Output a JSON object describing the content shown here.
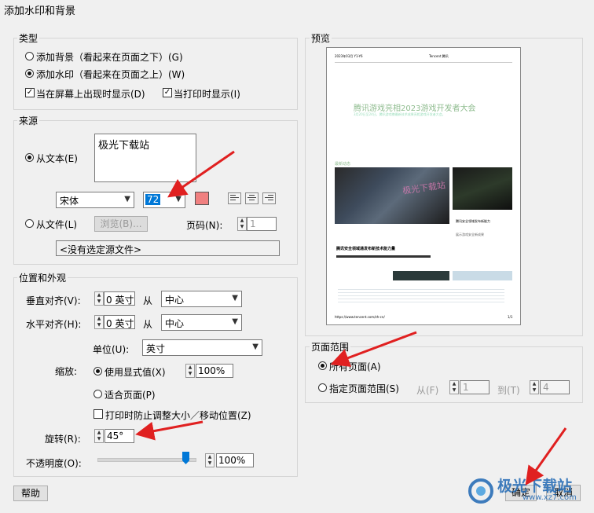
{
  "window_title": "添加水印和背景",
  "type_group": {
    "label": "类型",
    "add_background": "添加背景（看起来在页面之下）(G)",
    "add_watermark": "添加水印（看起来在页面之上）(W)",
    "show_on_screen": "当在屏幕上出现时显示(D)",
    "show_on_print": "当打印时显示(I)"
  },
  "source_group": {
    "label": "来源",
    "from_text": "从文本(E)",
    "text_value": "极光下载站",
    "font": "宋体",
    "font_size": "72",
    "from_file": "从文件(L)",
    "browse": "浏览(B)...",
    "page_label": "页码(N):",
    "page_value": "1",
    "file_path": "<没有选定源文件>"
  },
  "position_group": {
    "label": "位置和外观",
    "vertical_label": "垂直对齐(V):",
    "vertical_value": "0 英寸",
    "from1": "从",
    "vertical_anchor": "中心",
    "horizontal_label": "水平对齐(H):",
    "horizontal_value": "0 英寸",
    "from2": "从",
    "horizontal_anchor": "中心",
    "unit_label": "单位(U):",
    "unit_value": "英寸",
    "scale_label": "缩放:",
    "use_display_value": "使用显式值(X)",
    "scale_value": "100%",
    "fit_page": "适合页面(P)",
    "prevent_resize": "打印时防止调整大小／移动位置(Z)",
    "rotation_label": "旋转(R):",
    "rotation_value": "45°",
    "opacity_label": "不透明度(O):",
    "opacity_value": "100%"
  },
  "preview": {
    "label": "预览",
    "doc_header_left": "2023年03月 Y1-Y6",
    "doc_header_right": "Tencent 腾讯",
    "doc_title": "腾讯游戏亮相2023游戏开发者大会",
    "doc_subtitle": "3月20日至24日，腾讯游戏携最新技术成果亮相游戏开发者大会。",
    "doc_section": "最新动态",
    "doc_card_title": "腾讯安全领域发布新能力",
    "doc_card_desc": "展示游戏安全新成果",
    "doc_news_title": "腾讯安全领域通发布新技术能力量",
    "doc_footer_left": "https://www.tencent.com/zh-cn/",
    "doc_footer_right": "1/1"
  },
  "page_range_group": {
    "label": "页面范围",
    "all_pages": "所有页面(A)",
    "specified_range": "指定页面范围(S)",
    "from": "从(F)",
    "from_value": "1",
    "to": "到(T)",
    "to_value": "4"
  },
  "buttons": {
    "help": "帮助",
    "ok": "确定",
    "cancel": "取消"
  },
  "watermark_logo": {
    "text": "极光下载站",
    "url": "www.xz7.com"
  },
  "colors": {
    "swatch": "#f08080",
    "arrow": "#e02020",
    "preview_title": "#8fbc8f",
    "logo_blue": "#2a6fb7"
  }
}
